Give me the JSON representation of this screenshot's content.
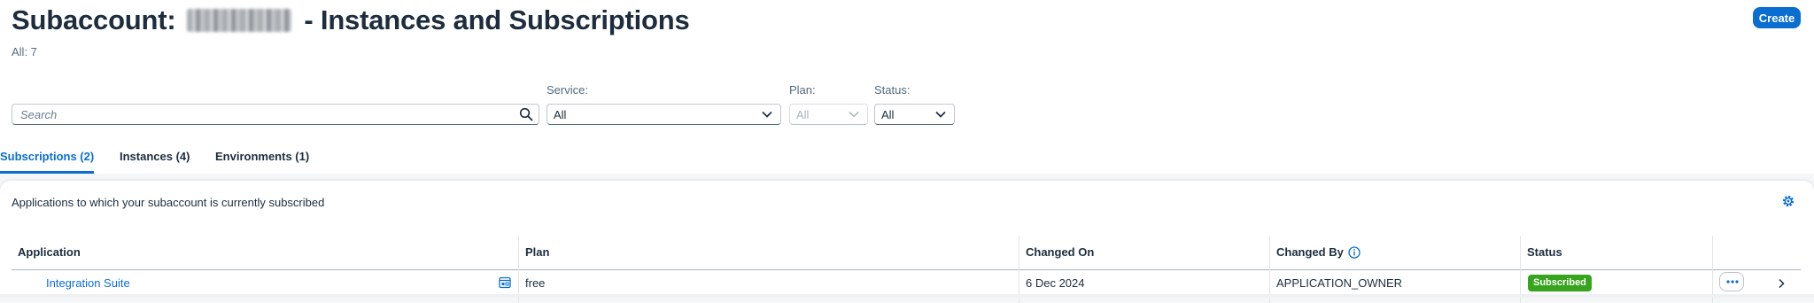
{
  "page": {
    "title_prefix": "Subaccount:",
    "title_suffix": "- Instances and Subscriptions",
    "count_label": "All: 7",
    "create_label": "Create"
  },
  "filters": {
    "search_placeholder": "Search",
    "service": {
      "label": "Service:",
      "value": "All"
    },
    "plan": {
      "label": "Plan:",
      "value": "All"
    },
    "status": {
      "label": "Status:",
      "value": "All"
    }
  },
  "tabs": [
    {
      "label": "Subscriptions (2)",
      "active": true
    },
    {
      "label": "Instances (4)",
      "active": false
    },
    {
      "label": "Environments (1)",
      "active": false
    }
  ],
  "table": {
    "description": "Applications to which your subaccount is currently subscribed",
    "columns": [
      "Application",
      "Plan",
      "Changed On",
      "Changed By",
      "Status"
    ],
    "rows": [
      {
        "application": "Integration Suite",
        "plan": "free",
        "changed_on": "6 Dec 2024",
        "changed_by": "APPLICATION_OWNER",
        "status": "Subscribed"
      }
    ]
  },
  "colors": {
    "accent": "#0a6ed1",
    "status_success": "#36a41d",
    "title_text": "#1d2d3e"
  },
  "icons": [
    "search-icon",
    "chevron-down-icon",
    "settings-icon",
    "info-icon",
    "application-icon",
    "more-icon",
    "chevron-right-icon"
  ]
}
